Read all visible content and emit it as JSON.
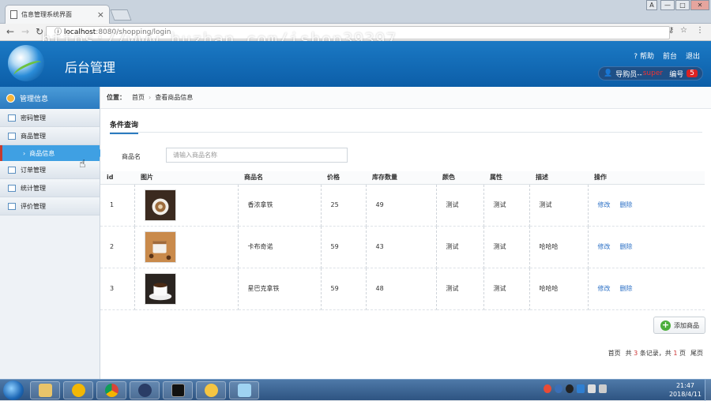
{
  "browser": {
    "tab_title": "信息管理系统界面",
    "tab_close": "×",
    "url_host": "localhost",
    "url_path": ":8080/shopping/login",
    "watermark": "https://www.huzhan.com/ishop39397",
    "win_buttons": [
      "A",
      "—",
      "□",
      "✕"
    ]
  },
  "header": {
    "title": "后台管理",
    "links": [
      "帮助",
      "前台",
      "退出"
    ],
    "help_glyph": "?",
    "user_label": "导购员--",
    "user_role": "super",
    "num_label": "编号",
    "num_value": "5"
  },
  "sidebar": {
    "title": "管理信息",
    "items": [
      {
        "label": "密码管理"
      },
      {
        "label": "商品管理"
      }
    ],
    "sub_item": "商品信息",
    "items_after": [
      {
        "label": "订单管理"
      },
      {
        "label": "统计管理"
      },
      {
        "label": "评价管理"
      }
    ]
  },
  "main": {
    "crumb_label": "位置：",
    "crumb_home": "首页",
    "crumb_sep": "›",
    "crumb_current": "查看商品信息",
    "filter_tab": "条件查询",
    "filter_label": "商品名",
    "filter_placeholder": "请输入商品名称",
    "columns": [
      "id",
      "图片",
      "商品名",
      "价格",
      "库存数量",
      "颜色",
      "属性",
      "描述",
      "操作"
    ],
    "rows": [
      {
        "id": "1",
        "name": "香浓拿铁",
        "price": "25",
        "stock": "49",
        "color": "测试",
        "attr": "测试",
        "desc": "测试",
        "edit": "修改",
        "del": "删除"
      },
      {
        "id": "2",
        "name": "卡布奇诺",
        "price": "59",
        "stock": "43",
        "color": "测试",
        "attr": "测试",
        "desc": "哈哈哈",
        "edit": "修改",
        "del": "删除"
      },
      {
        "id": "3",
        "name": "星巴克拿铁",
        "price": "59",
        "stock": "48",
        "color": "测试",
        "attr": "测试",
        "desc": "哈哈哈",
        "edit": "修改",
        "del": "删除"
      }
    ],
    "add_button": "添加商品",
    "pager": {
      "first": "首页",
      "total_pre": "共",
      "total": "3",
      "total_suf": "条记录，共",
      "pages": "1",
      "pages_suf": "页",
      "last": "尾页"
    }
  },
  "taskbar": {
    "time": "21:47",
    "date": "2018/4/11"
  },
  "colors": {
    "accent": "#2c7bc0",
    "selected": "#3fa0e3",
    "link": "#2a6fc5"
  }
}
